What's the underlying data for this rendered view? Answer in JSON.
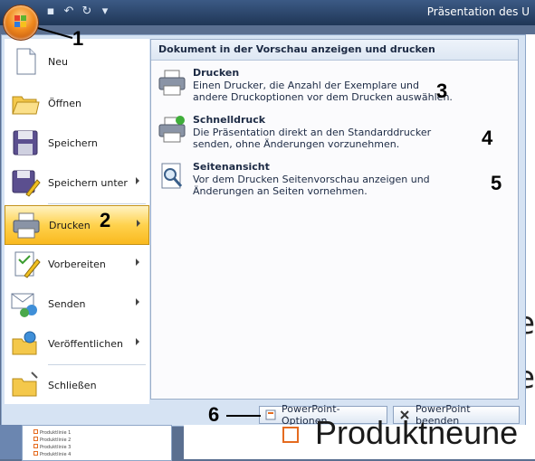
{
  "titlebar": {
    "title": "Präsentation des U"
  },
  "menu": {
    "left_items": [
      {
        "label": "Neu",
        "has_arrow": false
      },
      {
        "label": "Öffnen",
        "has_arrow": false
      },
      {
        "label": "Speichern",
        "has_arrow": false
      },
      {
        "label": "Speichern unter",
        "has_arrow": true
      },
      {
        "label": "Drucken",
        "has_arrow": true,
        "active": true
      },
      {
        "label": "Vorbereiten",
        "has_arrow": true
      },
      {
        "label": "Senden",
        "has_arrow": true
      },
      {
        "label": "Veröffentlichen",
        "has_arrow": true
      },
      {
        "label": "Schließen",
        "has_arrow": false
      }
    ],
    "submenu": {
      "header": "Dokument in der Vorschau anzeigen und drucken",
      "items": [
        {
          "title": "Drucken",
          "description": "Einen Drucker, die Anzahl der Exemplare und andere Druckoptionen vor dem Drucken auswählen."
        },
        {
          "title": "Schnelldruck",
          "description": "Die Präsentation direkt an den Standarddrucker senden, ohne Änderungen vorzunehmen."
        },
        {
          "title": "Seitenansicht",
          "description": "Vor dem Drucken Seitenvorschau anzeigen und Änderungen an Seiten vornehmen."
        }
      ]
    },
    "buttons": {
      "options": "PowerPoint-Optionen",
      "exit": "PowerPoint beenden"
    }
  },
  "callouts": [
    "1",
    "2",
    "3",
    "4",
    "5",
    "6"
  ],
  "background": {
    "slide_text": "Produktneune",
    "thumb_lines": [
      "Produktlinie 1",
      "Produktlinie 2",
      "Produktlinie 3",
      "Produktlinie 4"
    ],
    "edge_text": [
      "e",
      "e"
    ]
  },
  "colors": {
    "accent": "#f9b91f",
    "office_orange": "#f08a1e",
    "menu_bg": "#d6e3f3"
  }
}
